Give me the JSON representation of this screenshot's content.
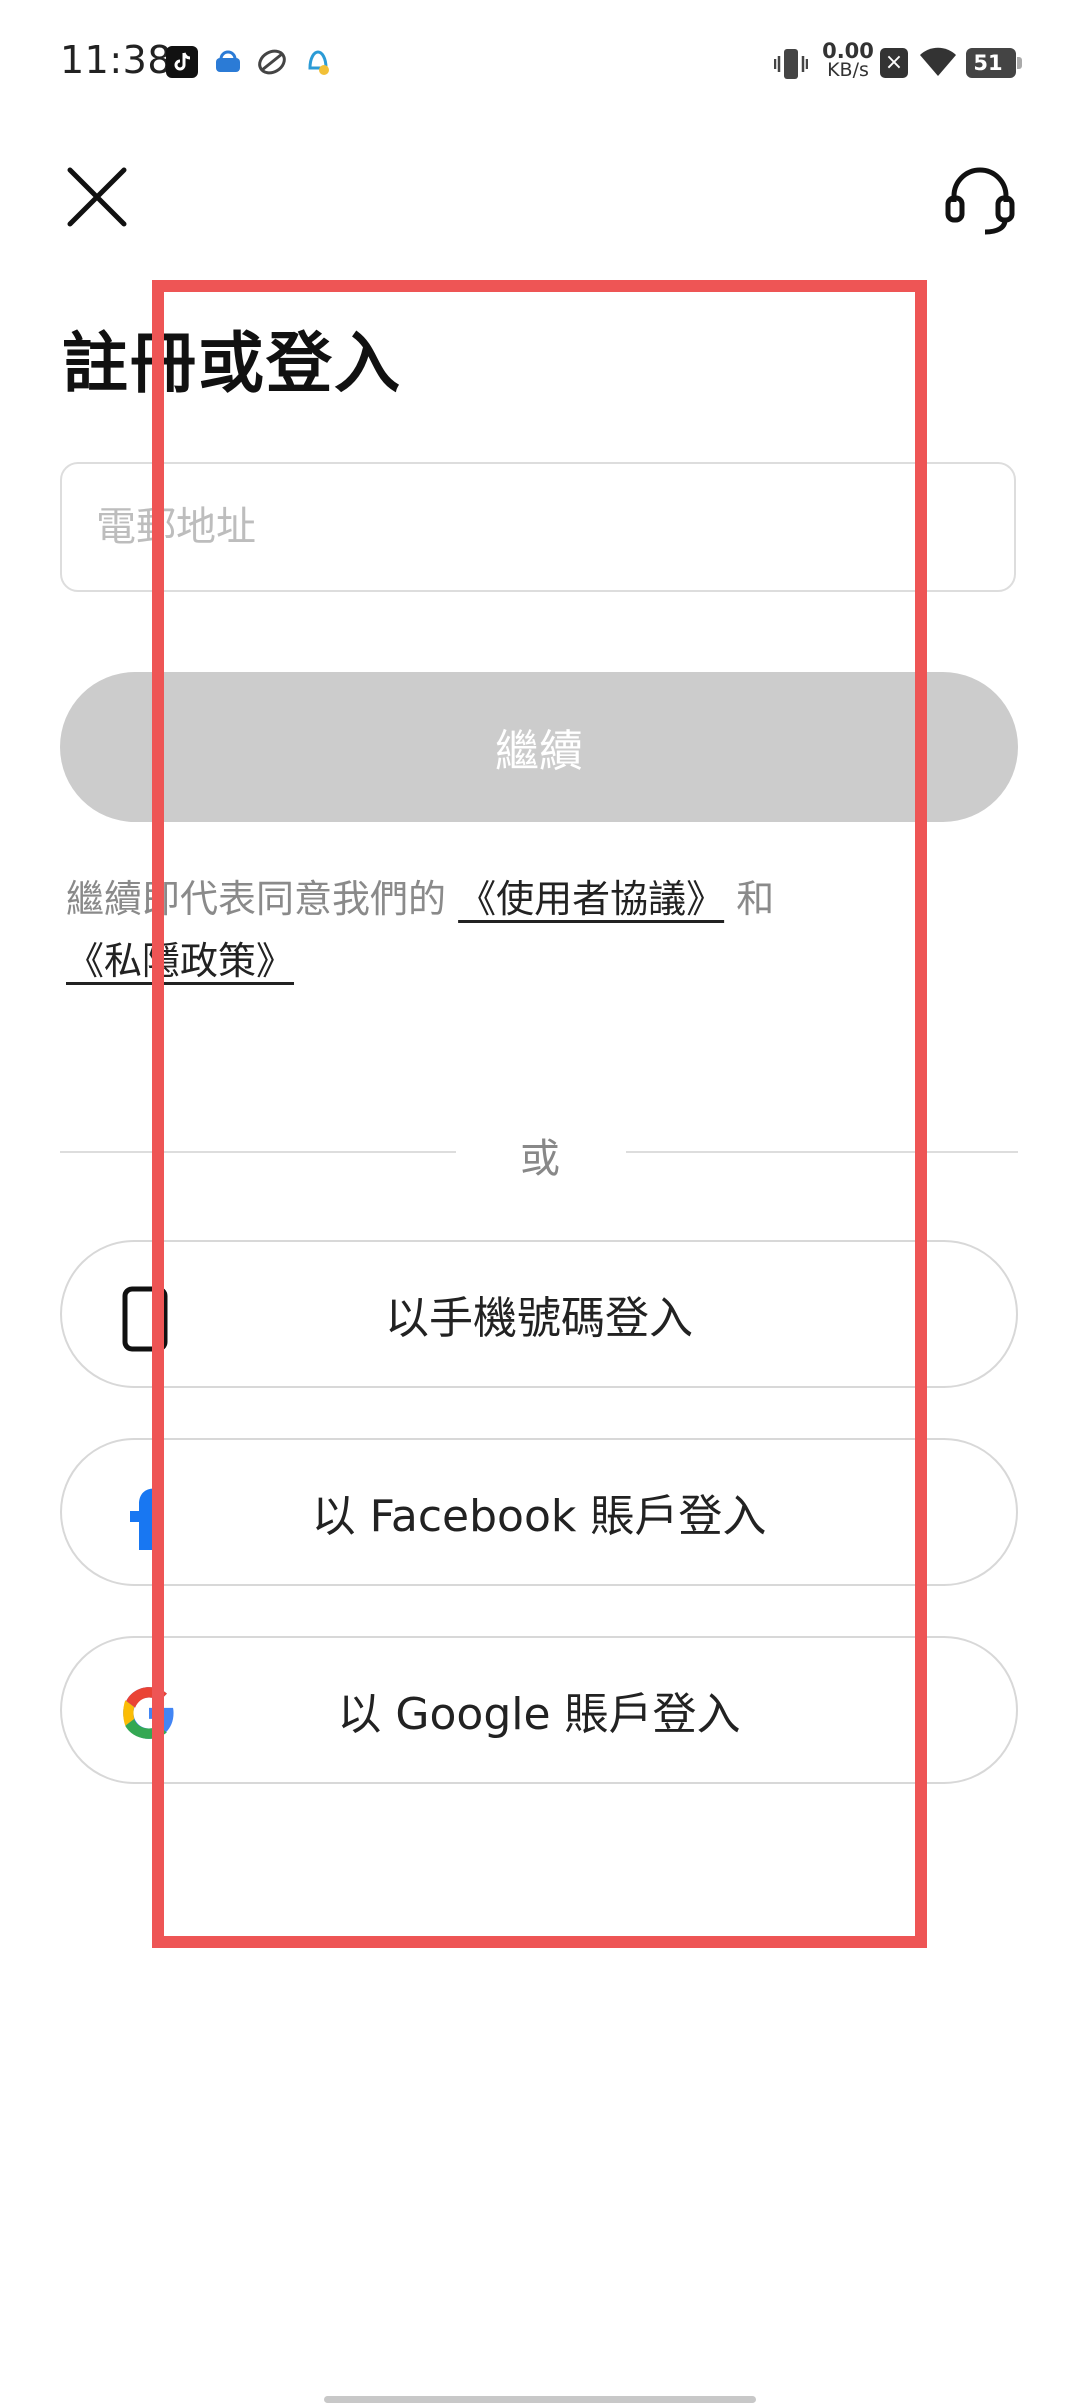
{
  "status_bar": {
    "time": "11:38",
    "net_speed_value": "0.00",
    "net_speed_unit": "KB/s",
    "battery": "51",
    "sim_icon": "sim-disabled-icon",
    "wifi_icon": "wifi-icon",
    "vibrate_icon": "vibrate-icon"
  },
  "header": {
    "close_icon": "close-icon",
    "support_icon": "headset-icon"
  },
  "page": {
    "title": "註冊或登入"
  },
  "email": {
    "placeholder": "電郵地址",
    "value": ""
  },
  "continue_button": {
    "label": "繼續"
  },
  "terms": {
    "prefix": "繼續即代表同意我們的",
    "user_agreement": "《使用者協議》",
    "and": "和",
    "privacy_policy": "《私隱政策》"
  },
  "divider": {
    "label": "或"
  },
  "alt_logins": [
    {
      "label": "以手機號碼登入",
      "icon": "phone-icon"
    },
    {
      "label": "以 Facebook 賬戶登入",
      "icon": "facebook-icon"
    },
    {
      "label": "以 Google 賬戶登入",
      "icon": "google-icon"
    }
  ],
  "colors": {
    "annotation_box": "#ee5555",
    "continue_disabled": "#cccccc",
    "facebook": "#1877f2"
  }
}
